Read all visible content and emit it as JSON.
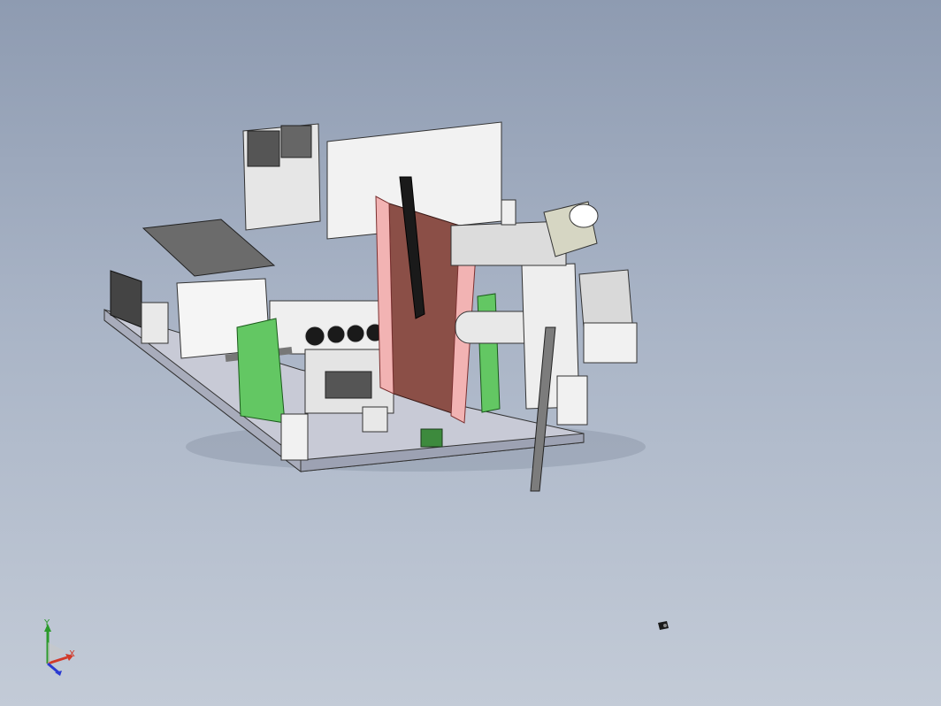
{
  "viewport": {
    "background_top": "#8e9bb1",
    "background_bottom": "#c3cbd7"
  },
  "triad": {
    "x_label": "X",
    "y_label": "Y",
    "x_color": "#d23a2a",
    "y_color": "#2a9a2a",
    "z_color": "#2a3ad2"
  },
  "model": {
    "accent_green": "#63c763",
    "accent_brown": "#8b4f47",
    "accent_pink": "#f2b3b3",
    "panel_white": "#f2f2f2",
    "base_gray": "#c8cad6"
  }
}
